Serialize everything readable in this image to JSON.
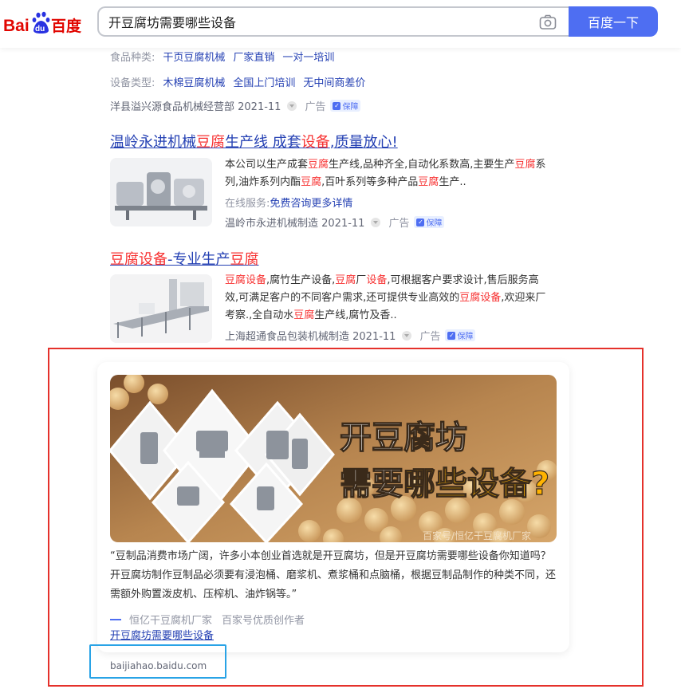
{
  "header": {
    "logo": {
      "text_bai": "Bai",
      "text_du": "du",
      "text_cn": "百度"
    },
    "search": {
      "query": "开豆腐坊需要哪些设备",
      "button_label": "百度一下"
    }
  },
  "result0": {
    "line1": {
      "label": "食品种类:",
      "links": [
        "干页豆腐机械",
        "厂家直销",
        "一对一培训"
      ]
    },
    "line2": {
      "label": "设备类型:",
      "links": [
        "木棉豆腐机械",
        "全国上门培训",
        "无中间商差价"
      ]
    },
    "source": "洋县溢兴源食品机械经营部 2021-11",
    "ad": "广告",
    "guarantee": "保障"
  },
  "result1": {
    "title": [
      "温岭永进机械",
      "豆腐",
      "生产线 成套",
      "设备",
      ",质量放心!"
    ],
    "desc": [
      "本公司以生产成套",
      "豆腐",
      "生产线,品种齐全,自动化系数高,主要生产",
      "豆腐",
      "系列,油炸系列内酯",
      "豆腐",
      ",百叶系列等多种产品",
      "豆腐",
      "生产.."
    ],
    "service_label": "在线服务:",
    "service_link": "免费咨询更多详情",
    "source": "温岭市永进机械制造 2021-11",
    "ad": "广告",
    "guarantee": "保障"
  },
  "result2": {
    "title": [
      "豆腐设备",
      "-专业生产",
      "豆腐"
    ],
    "desc": [
      "豆腐设备",
      ",腐竹生产设备,",
      "豆腐",
      "厂",
      "设备",
      ",可根据客户要求设计,售后服务高效,可满足客户的不同客户需求,还可提供专业高效的",
      "豆腐设备",
      ",欢迎来厂考察.,全自动水",
      "豆腐",
      "生产线,腐竹及香.."
    ],
    "source": "上海超通食品包装机械制造 2021-11",
    "ad": "广告",
    "guarantee": "保障"
  },
  "article": {
    "banner_line1": "开豆腐坊",
    "banner_line2a": "需要",
    "banner_line2b": "哪些设备?",
    "watermark": "百家号/恒亿干豆腐机厂家",
    "quote": "“豆制品消费市场广阔，许多小本创业首选就是开豆腐坊，但是开豆腐坊需要哪些设备你知道吗？开豆腐坊制作豆制品必须要有浸泡桶、磨浆机、煮浆桶和点脑桶，根据豆制品制作的种类不同，还需额外购置泼皮机、压榨机、油炸锅等。”",
    "author": "恒亿干豆腐机厂家",
    "author_cred": "百家号优质创作者",
    "link": "开豆腐坊需要哪些设备",
    "site": "baijiahao.baidu.com"
  },
  "colors": {
    "accent": "#4e6ef2",
    "link": "#2440b3",
    "highlight": "#f73131",
    "annotation_red": "#e5312b",
    "annotation_blue": "#29a3e6"
  }
}
